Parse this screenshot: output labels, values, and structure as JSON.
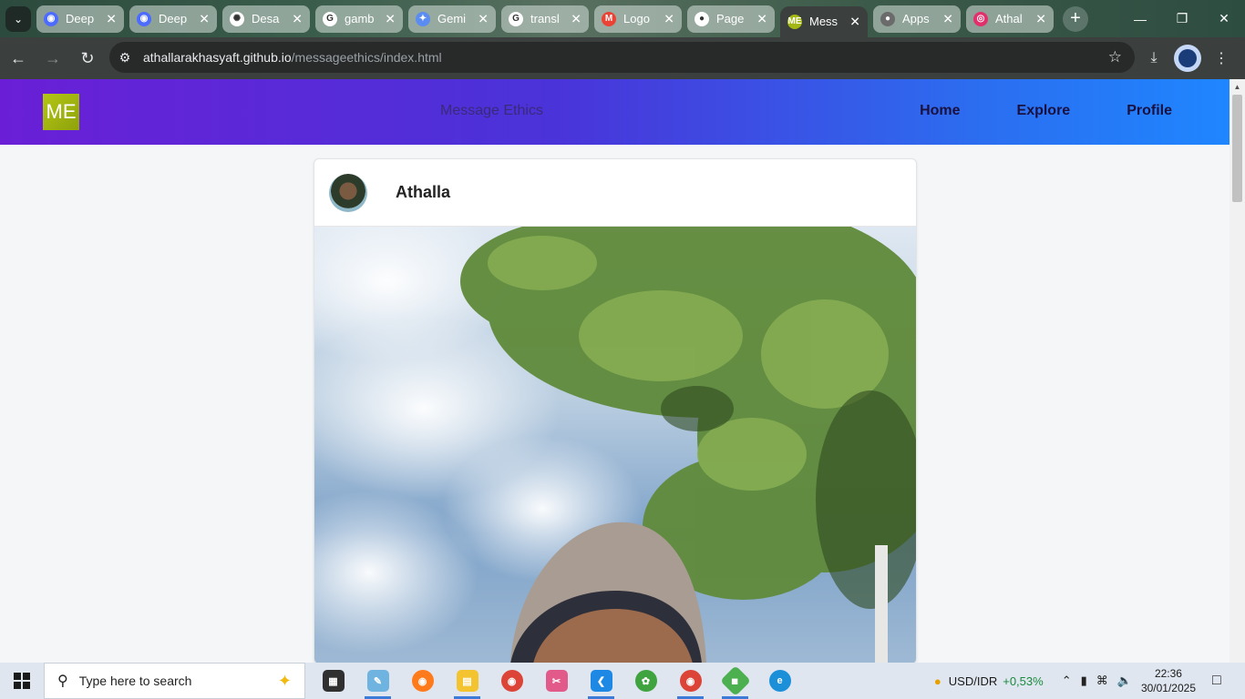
{
  "browser": {
    "tabs": [
      {
        "title": "Deep",
        "fav_color": "#4d6bfe",
        "fav_glyph": "◉"
      },
      {
        "title": "Deep",
        "fav_color": "#4d6bfe",
        "fav_glyph": "◉"
      },
      {
        "title": "Desa",
        "fav_color": "#ffffff",
        "fav_glyph": "✺"
      },
      {
        "title": "gamb",
        "fav_color": "#ffffff",
        "fav_glyph": "G"
      },
      {
        "title": "Gemi",
        "fav_color": "#5b8cf2",
        "fav_glyph": "✦"
      },
      {
        "title": "transl",
        "fav_color": "#ffffff",
        "fav_glyph": "G"
      },
      {
        "title": "Logo",
        "fav_color": "#ea4335",
        "fav_glyph": "M"
      },
      {
        "title": "Page",
        "fav_color": "#ffffff",
        "fav_glyph": "●"
      },
      {
        "title": "Mess",
        "fav_color": "#a4b814",
        "fav_glyph": "ME"
      },
      {
        "title": "Apps",
        "fav_color": "#6b6b6b",
        "fav_glyph": "●"
      },
      {
        "title": "Athal",
        "fav_color": "#e1306c",
        "fav_glyph": "◎"
      }
    ],
    "active_tab_index": 8,
    "url_host": "athallarakhasyaft.github.io",
    "url_path": "/messageethics/index.html"
  },
  "site": {
    "logo_text": "ME",
    "title": "Message Ethics",
    "nav": [
      "Home",
      "Explore",
      "Profile"
    ]
  },
  "post": {
    "author": "Athalla"
  },
  "taskbar": {
    "search_placeholder": "Type here to search",
    "ticker_label": "USD/IDR",
    "ticker_change": "+0,53%",
    "time": "22:36",
    "date": "30/01/2025"
  }
}
